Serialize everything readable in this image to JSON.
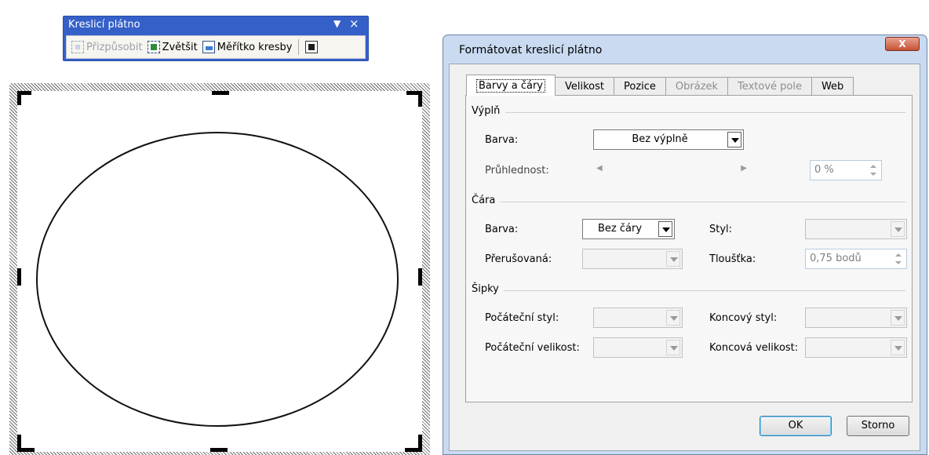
{
  "toolbar": {
    "title": "Kreslicí plátno",
    "menu_arrow": "▼",
    "close": "×",
    "buttons": {
      "fit": "Přizpůsobit",
      "expand": "Zvětšit",
      "scale": "Měřítko kresby"
    }
  },
  "dialog": {
    "title": "Formátovat kreslicí plátno",
    "close_label": "X",
    "tabs": [
      {
        "label": "Barvy a čáry",
        "state": "active"
      },
      {
        "label": "Velikost",
        "state": "enabled"
      },
      {
        "label": "Pozice",
        "state": "enabled"
      },
      {
        "label": "Obrázek",
        "state": "disabled"
      },
      {
        "label": "Textové pole",
        "state": "disabled"
      },
      {
        "label": "Web",
        "state": "enabled"
      }
    ],
    "fill": {
      "section": "Výplň",
      "color_label": "Barva:",
      "color_value": "Bez výplně",
      "transparency_label": "Průhlednost:",
      "transparency_value": "0 %",
      "slider_left": "◀",
      "slider_right": "▶"
    },
    "line": {
      "section": "Čára",
      "color_label": "Barva:",
      "color_value": "Bez čáry",
      "style_label": "Styl:",
      "style_value": "",
      "dashed_label": "Přerušovaná:",
      "dashed_value": "",
      "weight_label": "Tloušťka:",
      "weight_value": "0,75 bodů"
    },
    "arrows": {
      "section": "Šipky",
      "begin_style_label": "Počáteční styl:",
      "end_style_label": "Koncový styl:",
      "begin_size_label": "Počáteční velikost:",
      "end_size_label": "Koncová velikost:",
      "begin_style_value": "",
      "end_style_value": "",
      "begin_size_value": "",
      "end_size_value": ""
    },
    "buttons": {
      "ok": "OK",
      "cancel": "Storno"
    }
  },
  "colors": {
    "toolbar_title_bar": "#3560c8",
    "dialog_frame": "#c9daf1",
    "close_button": "#c65335"
  }
}
